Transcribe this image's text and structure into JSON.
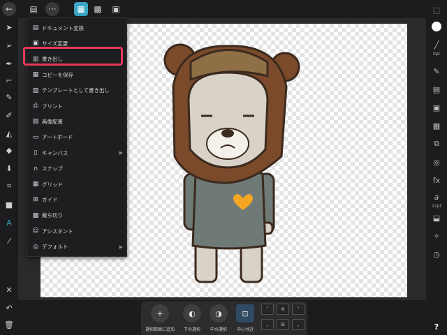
{
  "top_toolbar": {
    "back": "←",
    "document": "▤",
    "more": "···",
    "persona_designer": "▦",
    "persona_pixel": "▩",
    "persona_export": "▣",
    "right_icon": "⬚"
  },
  "menu": {
    "items": [
      {
        "label": "ドキュメント変換",
        "icon": "doc-convert-icon",
        "submenu": false
      },
      {
        "label": "サイズ変更",
        "icon": "resize-icon",
        "submenu": false
      },
      {
        "label": "書き出し",
        "icon": "export-icon",
        "submenu": false
      },
      {
        "label": "コピーを保存",
        "icon": "save-copy-icon",
        "submenu": false
      },
      {
        "label": "テンプレートとして書き出し",
        "icon": "template-icon",
        "submenu": false
      },
      {
        "label": "プリント",
        "icon": "print-icon",
        "submenu": false
      },
      {
        "label": "画像配置",
        "icon": "place-image-icon",
        "submenu": false
      },
      {
        "label": "アートボード",
        "icon": "artboard-icon",
        "submenu": false
      },
      {
        "label": "キャンバス",
        "icon": "canvas-icon",
        "submenu": true
      },
      {
        "label": "スナップ",
        "icon": "snap-icon",
        "submenu": false
      },
      {
        "label": "グリッド",
        "icon": "grid-icon",
        "submenu": false
      },
      {
        "label": "ガイド",
        "icon": "guide-icon",
        "submenu": false
      },
      {
        "label": "裁ち切り",
        "icon": "bleed-icon",
        "submenu": false
      },
      {
        "label": "アシスタント",
        "icon": "assistant-icon",
        "submenu": false
      },
      {
        "label": "デフォルト",
        "icon": "defaults-icon",
        "submenu": true
      }
    ],
    "highlighted": "書き出し"
  },
  "right_panel": {
    "stroke_width_label": "0pt",
    "text_size_label": "12pt",
    "help": "?"
  },
  "bottom_bar": {
    "buttons": [
      {
        "label": "選択範囲に追加",
        "icon": "+"
      },
      {
        "label": "下の選択",
        "icon": "◐"
      },
      {
        "label": "中の選択",
        "icon": "◑"
      },
      {
        "label": "中心付近",
        "icon": "⊡"
      }
    ]
  },
  "colors": {
    "accent": "#3aa6c6",
    "highlight_box": "#e8395a",
    "background": "#1c1c1e"
  }
}
